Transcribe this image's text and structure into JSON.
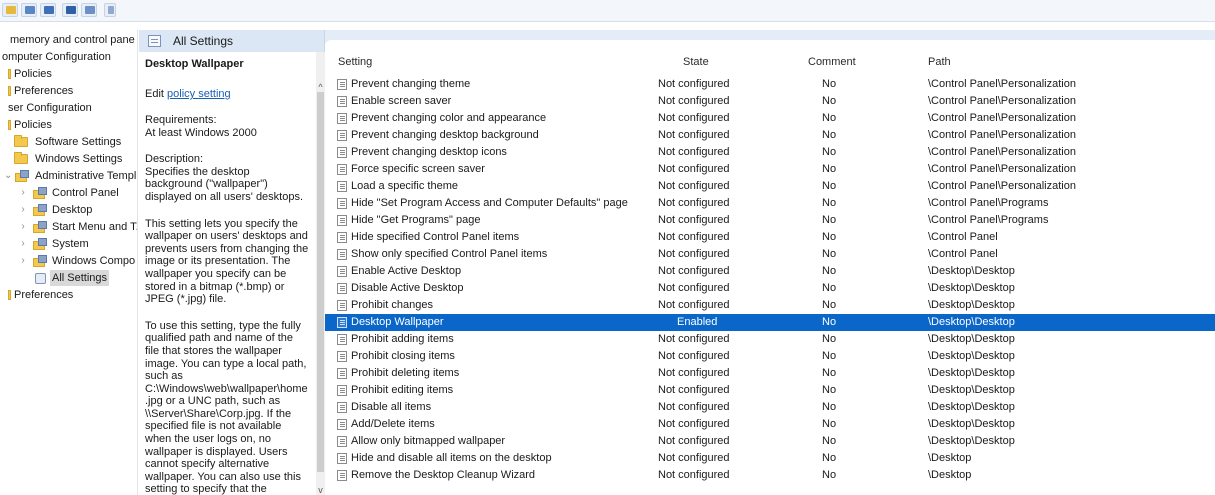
{
  "toolbar": {
    "buttons": [
      {
        "icon": "folder-icon",
        "color": "#e6b93c"
      },
      {
        "icon": "grid-icon",
        "color": "#5b86c4"
      },
      {
        "icon": "back-icon",
        "color": "#3e6fb8"
      },
      {
        "icon": "properties-icon",
        "color": "#2f5fa7"
      },
      {
        "icon": "view-icon",
        "color": "#6b8fc6"
      },
      {
        "icon": "filter-icon",
        "color": "#8fa9cf"
      }
    ]
  },
  "tree": {
    "items": [
      {
        "label": "memory and control pane"
      },
      {
        "label": "omputer Configuration"
      },
      {
        "label": "Policies"
      },
      {
        "label": "Preferences"
      },
      {
        "label": "ser Configuration"
      },
      {
        "label": "Policies"
      },
      {
        "label": "Software Settings"
      },
      {
        "label": "Windows Settings"
      },
      {
        "label": "Administrative Templ"
      },
      {
        "label": "Control Panel"
      },
      {
        "label": "Desktop"
      },
      {
        "label": "Start Menu and T."
      },
      {
        "label": "System"
      },
      {
        "label": "Windows Compo"
      },
      {
        "label": "All Settings"
      },
      {
        "label": "Preferences"
      }
    ]
  },
  "header": {
    "title": "All Settings"
  },
  "description": {
    "title": "Desktop Wallpaper",
    "edit_prefix": "Edit",
    "edit_link": "policy setting",
    "requirements_label": "Requirements:",
    "requirements_value": "At least Windows 2000",
    "description_label": "Description:",
    "description_text": "Specifies the desktop background (\"wallpaper\") displayed on all users' desktops.",
    "para2": "This setting lets you specify the wallpaper on users' desktops and prevents users from changing the image or its presentation. The wallpaper you specify can be stored in a bitmap (*.bmp) or JPEG (*.jpg) file.",
    "para3": "To use this setting, type the fully qualified path and name of the file that stores the wallpaper image. You can type a local path, such as C:\\Windows\\web\\wallpaper\\home .jpg or a UNC path, such as \\\\Server\\Share\\Corp.jpg. If the specified file is not available when the user logs on, no wallpaper is displayed. Users cannot specify alternative wallpaper. You can also use this setting to specify that the"
  },
  "list": {
    "columns": {
      "setting": "Setting",
      "state": "State",
      "comment": "Comment",
      "path": "Path"
    },
    "rows": [
      {
        "setting": "Prevent changing theme",
        "state": "Not configured",
        "comment": "No",
        "path": "\\Control Panel\\Personalization"
      },
      {
        "setting": "Enable screen saver",
        "state": "Not configured",
        "comment": "No",
        "path": "\\Control Panel\\Personalization"
      },
      {
        "setting": "Prevent changing color and appearance",
        "state": "Not configured",
        "comment": "No",
        "path": "\\Control Panel\\Personalization"
      },
      {
        "setting": "Prevent changing desktop background",
        "state": "Not configured",
        "comment": "No",
        "path": "\\Control Panel\\Personalization"
      },
      {
        "setting": "Prevent changing desktop icons",
        "state": "Not configured",
        "comment": "No",
        "path": "\\Control Panel\\Personalization"
      },
      {
        "setting": "Force specific screen saver",
        "state": "Not configured",
        "comment": "No",
        "path": "\\Control Panel\\Personalization"
      },
      {
        "setting": "Load a specific theme",
        "state": "Not configured",
        "comment": "No",
        "path": "\\Control Panel\\Personalization"
      },
      {
        "setting": "Hide \"Set Program Access and Computer Defaults\" page",
        "state": "Not configured",
        "comment": "No",
        "path": "\\Control Panel\\Programs"
      },
      {
        "setting": "Hide \"Get Programs\" page",
        "state": "Not configured",
        "comment": "No",
        "path": "\\Control Panel\\Programs"
      },
      {
        "setting": "Hide specified Control Panel items",
        "state": "Not configured",
        "comment": "No",
        "path": "\\Control Panel"
      },
      {
        "setting": "Show only specified Control Panel items",
        "state": "Not configured",
        "comment": "No",
        "path": "\\Control Panel"
      },
      {
        "setting": "Enable Active Desktop",
        "state": "Not configured",
        "comment": "No",
        "path": "\\Desktop\\Desktop"
      },
      {
        "setting": "Disable Active Desktop",
        "state": "Not configured",
        "comment": "No",
        "path": "\\Desktop\\Desktop"
      },
      {
        "setting": "Prohibit changes",
        "state": "Not configured",
        "comment": "No",
        "path": "\\Desktop\\Desktop"
      },
      {
        "setting": "Desktop Wallpaper",
        "state": "Enabled",
        "comment": "No",
        "path": "\\Desktop\\Desktop",
        "selected": true
      },
      {
        "setting": "Prohibit adding items",
        "state": "Not configured",
        "comment": "No",
        "path": "\\Desktop\\Desktop"
      },
      {
        "setting": "Prohibit closing items",
        "state": "Not configured",
        "comment": "No",
        "path": "\\Desktop\\Desktop"
      },
      {
        "setting": "Prohibit deleting items",
        "state": "Not configured",
        "comment": "No",
        "path": "\\Desktop\\Desktop"
      },
      {
        "setting": "Prohibit editing items",
        "state": "Not configured",
        "comment": "No",
        "path": "\\Desktop\\Desktop"
      },
      {
        "setting": "Disable all items",
        "state": "Not configured",
        "comment": "No",
        "path": "\\Desktop\\Desktop"
      },
      {
        "setting": "Add/Delete items",
        "state": "Not configured",
        "comment": "No",
        "path": "\\Desktop\\Desktop"
      },
      {
        "setting": "Allow only bitmapped wallpaper",
        "state": "Not configured",
        "comment": "No",
        "path": "\\Desktop\\Desktop"
      },
      {
        "setting": "Hide and disable all items on the desktop",
        "state": "Not configured",
        "comment": "No",
        "path": "\\Desktop"
      },
      {
        "setting": "Remove the Desktop Cleanup Wizard",
        "state": "Not configured",
        "comment": "No",
        "path": "\\Desktop"
      }
    ]
  },
  "colors": {
    "selection": "#0a66c9",
    "link": "#1a5fb4",
    "header_band": "#e4ecf7"
  }
}
